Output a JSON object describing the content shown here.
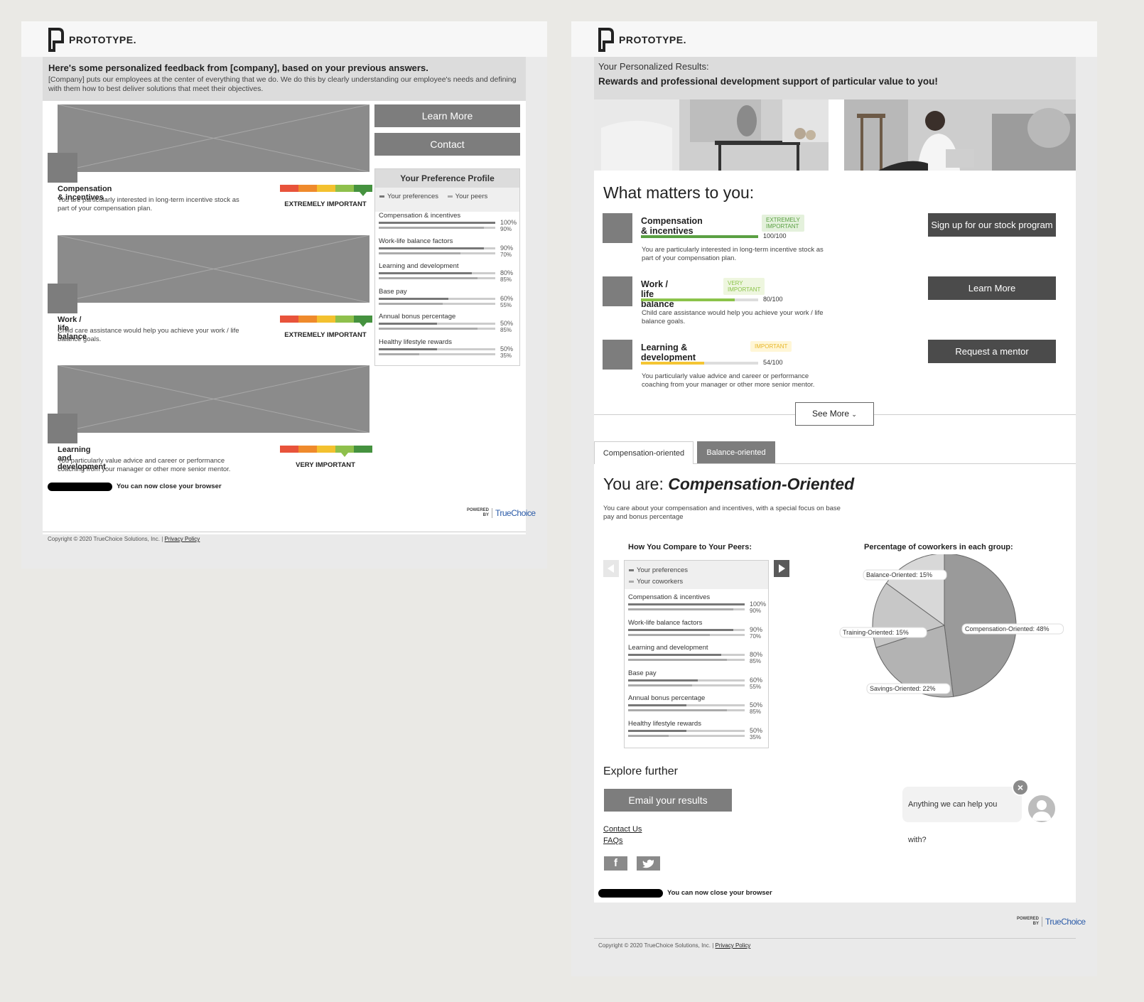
{
  "brand": {
    "name": "PROTOTYPE."
  },
  "left": {
    "heading": "Here's some personalized feedback from [company], based on your previous answers.",
    "intro": "[Company] puts our employees at the center of everything that we do. We do this by clearly understanding our employee's needs and defining with them how to best deliver solutions that meet their objectives.",
    "cards": [
      {
        "title": "Compensation & incentives",
        "desc": "You are particularly interested in long-term incentive stock as part of your compensation plan.",
        "rating": "EXTREMELY IMPORTANT",
        "level": 5
      },
      {
        "title": "Work / life balance",
        "desc": "Child care assistance would help you achieve your work / life balance goals.",
        "rating": "EXTREMELY IMPORTANT",
        "level": 5
      },
      {
        "title": "Learning and development",
        "desc": "You particularly value advice and career or performance coaching from your manager or other more senior mentor.",
        "rating": "VERY IMPORTANT",
        "level": 4
      }
    ],
    "buttons": {
      "learn_more": "Learn More",
      "contact": "Contact"
    },
    "profile": {
      "title": "Your Preference Profile",
      "legend_you": "Your preferences",
      "legend_peers": "Your peers"
    },
    "close_text": "You can now close your browser"
  },
  "preferences": [
    {
      "label": "Compensation & incentives",
      "you": 100,
      "peer": 90,
      "you_text": "100%",
      "peer_text": "90%"
    },
    {
      "label": "Work-life balance factors",
      "you": 90,
      "peer": 70,
      "you_text": "90%",
      "peer_text": "70%"
    },
    {
      "label": "Learning and development",
      "you": 80,
      "peer": 85,
      "you_text": "80%",
      "peer_text": "85%"
    },
    {
      "label": "Base pay",
      "you": 60,
      "peer": 55,
      "you_text": "60%",
      "peer_text": "55%"
    },
    {
      "label": "Annual bonus percentage",
      "you": 50,
      "peer": 85,
      "you_text": "50%",
      "peer_text": "85%"
    },
    {
      "label": "Healthy lifestyle rewards",
      "you": 50,
      "peer": 35,
      "you_text": "50%",
      "peer_text": "35%"
    }
  ],
  "right": {
    "results_title": "Your Personalized Results:",
    "results_sub": "Rewards and professional development support of particular value to you!",
    "matters_title": "What matters to you:",
    "items": [
      {
        "title": "Compensation & incentives",
        "badge": "EXTREMELY IMPORTANT",
        "score": "100/100",
        "value": 100,
        "desc": "You are particularly interested in long-term incentive stock as part of your compensation plan.",
        "action": "Sign up for our stock program"
      },
      {
        "title": "Work / life balance",
        "badge": "VERY IMPORTANT",
        "score": "80/100",
        "value": 80,
        "desc": "Child care assistance would help you achieve your work / life balance goals.",
        "action": "Learn More"
      },
      {
        "title": "Learning & development",
        "badge": "IMPORTANT",
        "score": "54/100",
        "value": 54,
        "desc": "You particularly value advice and career or performance coaching from your manager or other more senior mentor.",
        "action": "Request a mentor"
      }
    ],
    "see_more": "See More",
    "tabs": [
      "Compensation-oriented",
      "Balance-oriented"
    ],
    "you_are_prefix": "You are:",
    "you_are_type": "Compensation-Oriented",
    "you_are_desc": "You care about your compensation and incentives, with a special focus on base pay and bonus percentage",
    "compare_title": "How You Compare to Your Peers:",
    "legend_you": "Your preferences",
    "legend_coworkers": "Your coworkers",
    "pie_title": "Percentage of coworkers in each group:",
    "explore_title": "Explore further",
    "email_button": "Email your results",
    "links": [
      "Contact Us",
      "FAQs"
    ],
    "chat_text": "Anything we can help you with?",
    "close_text": "You can now close your browser"
  },
  "pie": [
    {
      "label": "Compensation-Oriented: 48%",
      "value": 48,
      "color": "#9a9a9a"
    },
    {
      "label": "Savings-Oriented: 22%",
      "value": 22,
      "color": "#b3b3b3"
    },
    {
      "label": "Training-Oriented: 15%",
      "value": 15,
      "color": "#c7c7c7"
    },
    {
      "label": "Balance-Oriented: 15%",
      "value": 15,
      "color": "#d8d8d8"
    }
  ],
  "footer": {
    "copyright": "Copyright © 2020 TrueChoice Solutions, Inc. |",
    "privacy": "Privacy Policy",
    "powered": "POWERED BY",
    "truechoice": "TrueChoice"
  },
  "colors": {
    "rating": [
      "#e8533b",
      "#ef8a2c",
      "#f3c12f",
      "#8ec04c",
      "#45923f"
    ],
    "green": "#5aa043",
    "lightgreen": "#8bc34a",
    "yellow": "#f4c534"
  }
}
